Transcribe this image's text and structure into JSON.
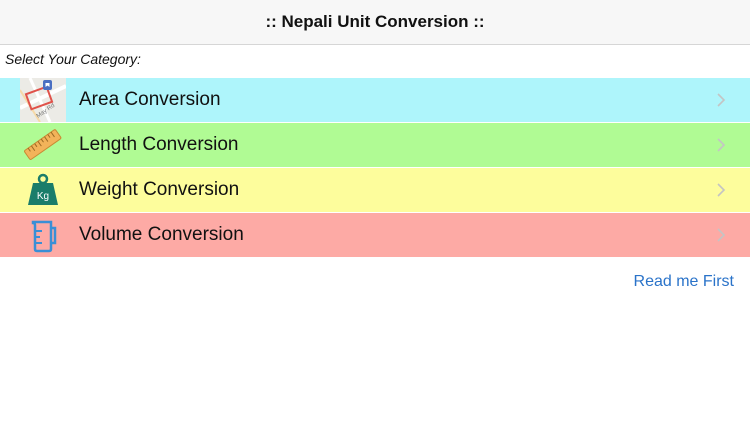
{
  "header": {
    "title": ":: Nepali Unit Conversion ::"
  },
  "category_prompt": "Select Your Category:",
  "colors": {
    "area": "#aef5fb",
    "length": "#b0fb94",
    "weight": "#fdfd9c",
    "volume": "#fdaaa5",
    "link": "#2a73c9",
    "chevron": "#c4c4c4"
  },
  "categories": [
    {
      "label": "Area Conversion",
      "icon": "map-icon"
    },
    {
      "label": "Length Conversion",
      "icon": "ruler-icon"
    },
    {
      "label": "Weight Conversion",
      "icon": "weight-icon"
    },
    {
      "label": "Volume Conversion",
      "icon": "measuring-cup-icon"
    }
  ],
  "icons": {
    "weight_text": "Kg",
    "map_text": "May Rd"
  },
  "footer": {
    "read_me": "Read me First"
  }
}
